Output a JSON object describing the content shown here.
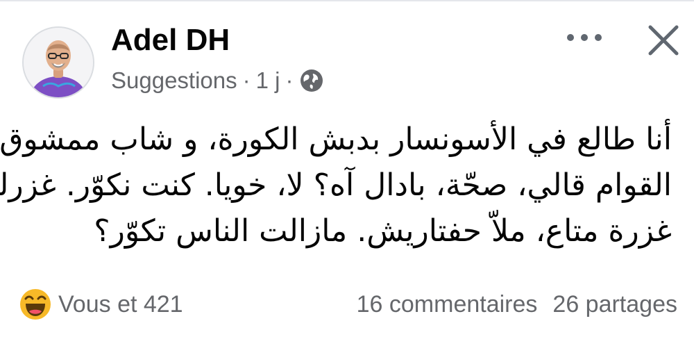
{
  "post": {
    "author": "Adel DH",
    "meta_source": "Suggestions",
    "meta_sep1": "·",
    "meta_time": "1 j",
    "meta_sep2": "·",
    "audience_icon": "globe-icon",
    "menu_icon": "more-dots-icon",
    "close_icon": "close-icon",
    "text_lines": [
      "أنا طالع في الأسونسار بدبش الكورة، و شاب ممشوق",
      "القوام قالي، صحّة، بادال آه؟ لا، خويا. كنت نكوّر. غزرلي",
      "غزرة متاع، ملاّ حفتاريش. مازالت الناس تكوّر؟"
    ]
  },
  "footer": {
    "reaction_icon": "haha-emoji-icon",
    "reactions_label": "Vous et 421",
    "comments_label": "16 commentaires",
    "shares_label": "26 partages"
  },
  "colors": {
    "primary_text": "#050505",
    "secondary_text": "#65676b",
    "reaction_yellow": "#f7b928"
  }
}
